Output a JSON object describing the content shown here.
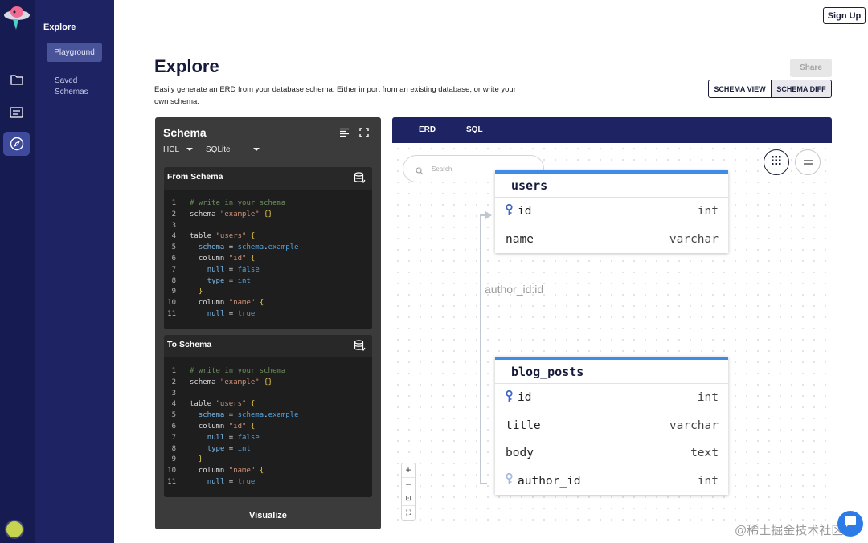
{
  "nav": {
    "section_title": "Explore",
    "items": [
      {
        "label": "Playground"
      },
      {
        "label": "Saved Schemas"
      }
    ]
  },
  "header": {
    "signup_label": "Sign Up",
    "title": "Explore",
    "subtitle": "Easily generate an ERD from your database schema. Either import from an existing database, or write your own schema.",
    "share_label": "Share",
    "view_toggle": [
      "SCHEMA VIEW",
      "SCHEMA DIFF"
    ]
  },
  "schema_panel": {
    "title": "Schema",
    "format": "HCL",
    "dialect": "SQLite",
    "editors": [
      {
        "title": "From Schema",
        "lines": [
          [
            [
              "c",
              "# write in your schema"
            ]
          ],
          [
            [
              "k",
              "schema "
            ],
            [
              "s",
              "\"example\" "
            ],
            [
              "b",
              "{}"
            ]
          ],
          [],
          [
            [
              "k",
              "table "
            ],
            [
              "s",
              "\"users\" "
            ],
            [
              "b",
              "{"
            ]
          ],
          [
            [
              "k",
              "  "
            ],
            [
              "a",
              "schema"
            ],
            [
              "k",
              " = "
            ],
            [
              "v",
              "schema"
            ],
            [
              "k",
              "."
            ],
            [
              "v",
              "example"
            ]
          ],
          [
            [
              "k",
              "  column "
            ],
            [
              "s",
              "\"id\" "
            ],
            [
              "b",
              "{"
            ]
          ],
          [
            [
              "k",
              "    "
            ],
            [
              "a",
              "null"
            ],
            [
              "k",
              " = "
            ],
            [
              "v",
              "false"
            ]
          ],
          [
            [
              "k",
              "    "
            ],
            [
              "a",
              "type"
            ],
            [
              "k",
              " = "
            ],
            [
              "v",
              "int"
            ]
          ],
          [
            [
              "k",
              "  "
            ],
            [
              "b",
              "}"
            ]
          ],
          [
            [
              "k",
              "  column "
            ],
            [
              "s",
              "\"name\" "
            ],
            [
              "b",
              "{"
            ]
          ],
          [
            [
              "k",
              "    "
            ],
            [
              "a",
              "null"
            ],
            [
              "k",
              " = "
            ],
            [
              "v",
              "true"
            ]
          ]
        ]
      },
      {
        "title": "To Schema",
        "lines": [
          [
            [
              "c",
              "# write in your schema"
            ]
          ],
          [
            [
              "k",
              "schema "
            ],
            [
              "s",
              "\"example\" "
            ],
            [
              "b",
              "{}"
            ]
          ],
          [],
          [
            [
              "k",
              "table "
            ],
            [
              "s",
              "\"users\" "
            ],
            [
              "b",
              "{"
            ]
          ],
          [
            [
              "k",
              "  "
            ],
            [
              "a",
              "schema"
            ],
            [
              "k",
              " = "
            ],
            [
              "v",
              "schema"
            ],
            [
              "k",
              "."
            ],
            [
              "v",
              "example"
            ]
          ],
          [
            [
              "k",
              "  column "
            ],
            [
              "s",
              "\"id\" "
            ],
            [
              "b",
              "{"
            ]
          ],
          [
            [
              "k",
              "    "
            ],
            [
              "a",
              "null"
            ],
            [
              "k",
              " = "
            ],
            [
              "v",
              "false"
            ]
          ],
          [
            [
              "k",
              "    "
            ],
            [
              "a",
              "type"
            ],
            [
              "k",
              " = "
            ],
            [
              "v",
              "int"
            ]
          ],
          [
            [
              "k",
              "  "
            ],
            [
              "b",
              "}"
            ]
          ],
          [
            [
              "k",
              "  column "
            ],
            [
              "s",
              "\"name\" "
            ],
            [
              "b",
              "{"
            ]
          ],
          [
            [
              "k",
              "    "
            ],
            [
              "a",
              "null"
            ],
            [
              "k",
              " = "
            ],
            [
              "v",
              "true"
            ]
          ]
        ]
      }
    ],
    "visualize_label": "Visualize"
  },
  "erd": {
    "tabs": [
      "ERD",
      "SQL"
    ],
    "search_placeholder": "Search",
    "relation_label": "author_id:id",
    "tables": [
      {
        "name": "users",
        "columns": [
          {
            "name": "id",
            "type": "int",
            "key": "primary"
          },
          {
            "name": "name",
            "type": "varchar",
            "key": ""
          }
        ]
      },
      {
        "name": "blog_posts",
        "columns": [
          {
            "name": "id",
            "type": "int",
            "key": "primary"
          },
          {
            "name": "title",
            "type": "varchar",
            "key": ""
          },
          {
            "name": "body",
            "type": "text",
            "key": ""
          },
          {
            "name": "author_id",
            "type": "int",
            "key": "foreign"
          }
        ]
      }
    ],
    "zoom_controls": [
      "+",
      "−",
      "⊡",
      "⛶"
    ]
  },
  "watermark": "@稀土掘金技术社区",
  "colors": {
    "sidebar": "#1d2363",
    "rail": "#161c52",
    "accent_blue": "#3f8be8",
    "primary_key": "#3f67c8",
    "foreign_key": "#a9b8dd"
  }
}
